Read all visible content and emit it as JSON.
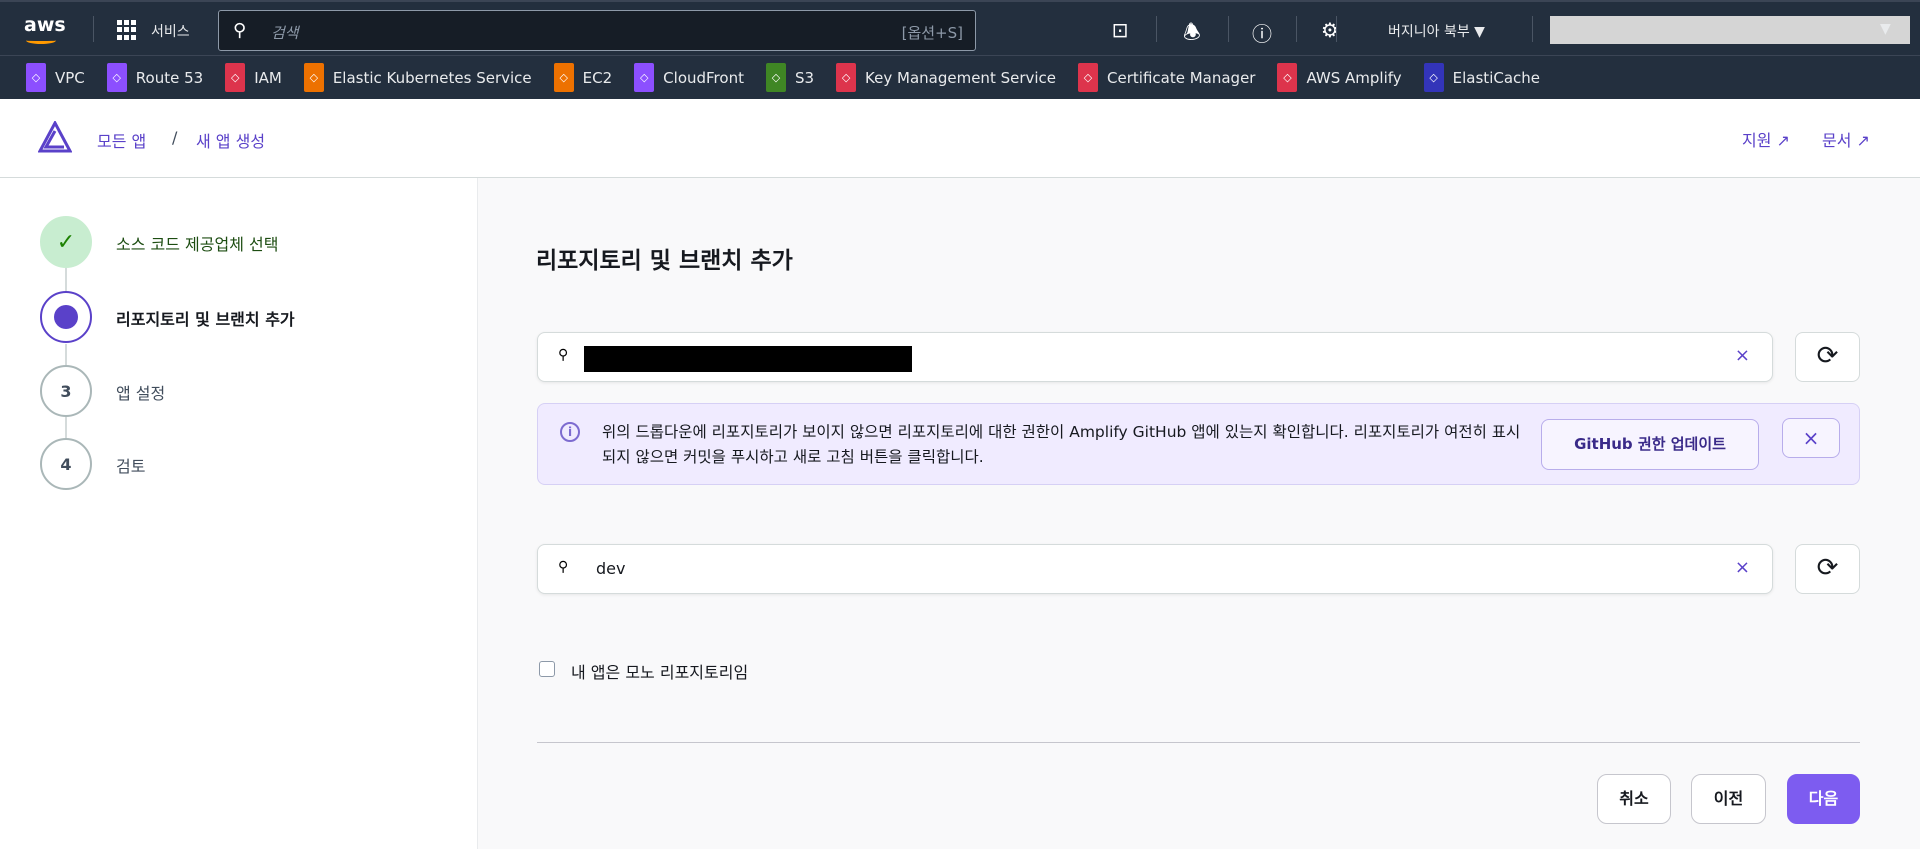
{
  "topbar": {
    "services_label": "서비스",
    "search_placeholder": "검색",
    "search_shortcut": "[옵션+S]",
    "region": "버지니아 북부 ▼",
    "account_caret": "▼"
  },
  "favorites": [
    {
      "label": "VPC",
      "color": "#8c4fff"
    },
    {
      "label": "Route 53",
      "color": "#8c4fff"
    },
    {
      "label": "IAM",
      "color": "#dd344c"
    },
    {
      "label": "Elastic Kubernetes Service",
      "color": "#ed7100"
    },
    {
      "label": "EC2",
      "color": "#ed7100"
    },
    {
      "label": "CloudFront",
      "color": "#8c4fff"
    },
    {
      "label": "S3",
      "color": "#3f8624"
    },
    {
      "label": "Key Management Service",
      "color": "#dd344c"
    },
    {
      "label": "Certificate Manager",
      "color": "#dd344c"
    },
    {
      "label": "AWS Amplify",
      "color": "#dd344c"
    },
    {
      "label": "ElastiCache",
      "color": "#3334b9"
    }
  ],
  "header": {
    "breadcrumb_root": "모든 앱",
    "breadcrumb_sep": "/",
    "breadcrumb_current": "새 앱 생성",
    "support": "지원",
    "docs": "문서"
  },
  "steps": [
    {
      "num": "✓",
      "label": "소스 코드 제공업체 선택",
      "state": "done"
    },
    {
      "num": "",
      "label": "리포지토리 및 브랜치 추가",
      "state": "current"
    },
    {
      "num": "3",
      "label": "앱 설정",
      "state": "pending"
    },
    {
      "num": "4",
      "label": "검토",
      "state": "pending"
    }
  ],
  "main": {
    "title": "리포지토리 및 브랜치 추가",
    "branch_value": "dev",
    "info_text": "위의 드롭다운에 리포지토리가 보이지 않으면 리포지토리에 대한 권한이 Amplify GitHub 앱에 있는지 확인합니다. 리포지토리가 여전히 표시되지 않으면 커밋을 푸시하고 새로 고침 버튼을 클릭합니다.",
    "github_button": "GitHub 권한 업데이트",
    "monorepo_label": "내 앱은 모노 리포지토리임",
    "cancel": "취소",
    "previous": "이전",
    "next": "다음"
  }
}
